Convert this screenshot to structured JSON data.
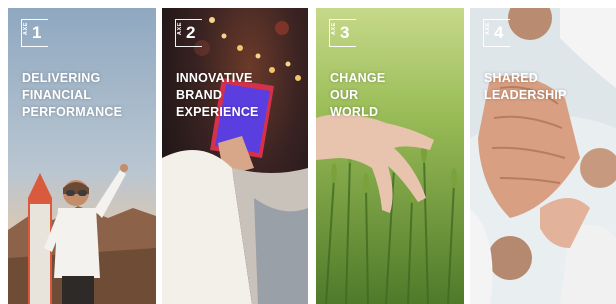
{
  "panels": [
    {
      "label": "AXE",
      "number": "1",
      "title_lines": [
        "DELIVERING",
        "FINANCIAL",
        "PERFORMANCE"
      ]
    },
    {
      "label": "AXE",
      "number": "2",
      "title_lines": [
        "INNOVATIVE",
        "BRAND",
        "EXPERIENCE"
      ]
    },
    {
      "label": "AXE",
      "number": "3",
      "title_lines": [
        "CHANGE",
        "OUR",
        "WORLD"
      ]
    },
    {
      "label": "AXE",
      "number": "4",
      "title_lines": [
        "SHARED",
        "LEADERSHIP"
      ]
    }
  ],
  "colors": {
    "panel1_sky": "#9fb6cc",
    "panel2_night": "#2b1c1e",
    "panel3_field": "#6f9a3e",
    "panel4_light": "#e9eef0"
  }
}
